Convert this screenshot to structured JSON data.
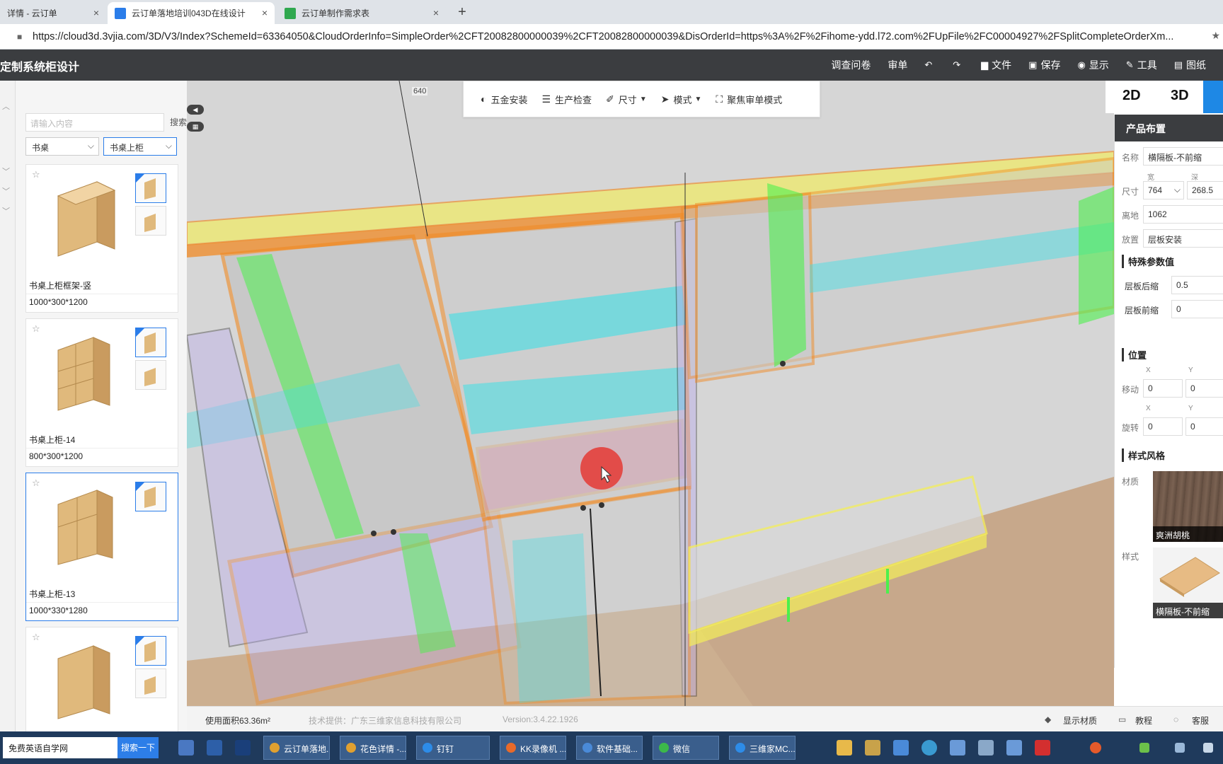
{
  "browser": {
    "tabs": [
      {
        "label": "详情 - 云订单",
        "active": false
      },
      {
        "label": "云订单落地培训043D在线设计",
        "active": true
      },
      {
        "label": "云订单制作需求表",
        "active": false
      }
    ],
    "new_tab": "+",
    "close": "×",
    "url": "https://cloud3d.3vjia.com/3D/V3/Index?SchemeId=63364050&CloudOrderInfo=SimpleOrder%2CFT20082800000039%2CFT20082800000039&DisOrderId=https%3A%2F%2Fihome-ydd.l72.com%2FUpFile%2FC00004927%2FSplitCompleteOrderXm..."
  },
  "app": {
    "title": "定制系统柜设计",
    "menu": [
      {
        "label": "调查问卷",
        "icon": ""
      },
      {
        "label": "审单",
        "icon": ""
      },
      {
        "label": "",
        "icon": "undo-icon",
        "glyph": "↶"
      },
      {
        "label": "",
        "icon": "redo-icon",
        "glyph": "↷"
      },
      {
        "label": "文件",
        "icon": "folder-icon",
        "glyph": "▆"
      },
      {
        "label": "保存",
        "icon": "save-icon",
        "glyph": "▣"
      },
      {
        "label": "显示",
        "icon": "eye-icon",
        "glyph": "◉"
      },
      {
        "label": "工具",
        "icon": "wrench-icon",
        "glyph": "✎"
      },
      {
        "label": "图纸",
        "icon": "book-icon",
        "glyph": "▤"
      }
    ]
  },
  "catalog": {
    "search_placeholder": "请输入内容",
    "search_button": "搜索",
    "category": "书桌",
    "subcategory": "书桌上柜",
    "items": [
      {
        "name": "书桌上柜框架-竖",
        "dims": "1000*300*1200",
        "selected": false
      },
      {
        "name": "书桌上柜-14",
        "dims": "800*300*1200",
        "selected": false
      },
      {
        "name": "书桌上柜-13",
        "dims": "1000*330*1280",
        "selected": true
      },
      {
        "name": "",
        "dims": "",
        "selected": false
      }
    ]
  },
  "viewport": {
    "toolbar": [
      {
        "label": "五金安装",
        "icon": "hardware-icon",
        "glyph": "◐"
      },
      {
        "label": "生产检查",
        "icon": "checklist-icon",
        "glyph": "☰"
      },
      {
        "label": "尺寸",
        "icon": "ruler-icon",
        "glyph": "✐",
        "dropdown": true
      },
      {
        "label": "模式",
        "icon": "cursor-icon",
        "glyph": "➤",
        "dropdown": true
      },
      {
        "label": "聚焦审单模式",
        "icon": "focus-icon",
        "glyph": "⛶"
      }
    ],
    "dimension_label": "640"
  },
  "status": {
    "area": "使用面积63.36m²",
    "provider": "技术提供：广东三维家信息科技有限公司",
    "version": "Version:3.4.22.1926",
    "show_material": "显示材质",
    "tutorial": "教程",
    "service": "客服"
  },
  "view_switch": {
    "two_d": "2D",
    "three_d": "3D"
  },
  "properties": {
    "title": "产品布置",
    "name_label": "名称",
    "name_value": "横隔板-不前缩",
    "size_label": "尺寸",
    "width_label": "宽",
    "depth_label": "深",
    "width_value": "764",
    "depth_value": "268.5",
    "height_label": "离地",
    "height_value": "1062",
    "place_label": "放置",
    "place_value": "层板安装",
    "special_title": "特殊参数值",
    "shelf_back_label": "层板后缩",
    "shelf_back_value": "0.5",
    "shelf_front_label": "层板前缩",
    "shelf_front_value": "0",
    "position_title": "位置",
    "move_label": "移动",
    "rotate_label": "旋转",
    "x_label": "X",
    "y_label": "Y",
    "move_x": "0",
    "move_y": "0",
    "rotate_x": "0",
    "rotate_y": "0",
    "style_title": "样式风格",
    "material_label": "材质",
    "material_value": "爽洲胡桃",
    "style_label": "样式",
    "style_value": "横隔板-不前缩"
  },
  "taskbar": {
    "search_text": "免费英语自学网",
    "search_button": "搜索一下",
    "tasks": [
      "云订单落地...",
      "花色详情 -...",
      "钉钉",
      "KK录像机 ...",
      "软件基础...",
      "微信",
      "三维家MC..."
    ]
  },
  "colors": {
    "accent": "#1e88e5",
    "header": "#3b3d40",
    "edge_orange": "#f08a24",
    "edge_yellow": "#f4ee5a",
    "panel_green": "#4cf04c",
    "panel_cyan": "#3fe0e6",
    "panel_violet": "#b8a8f0",
    "selection_red": "#e53935"
  }
}
